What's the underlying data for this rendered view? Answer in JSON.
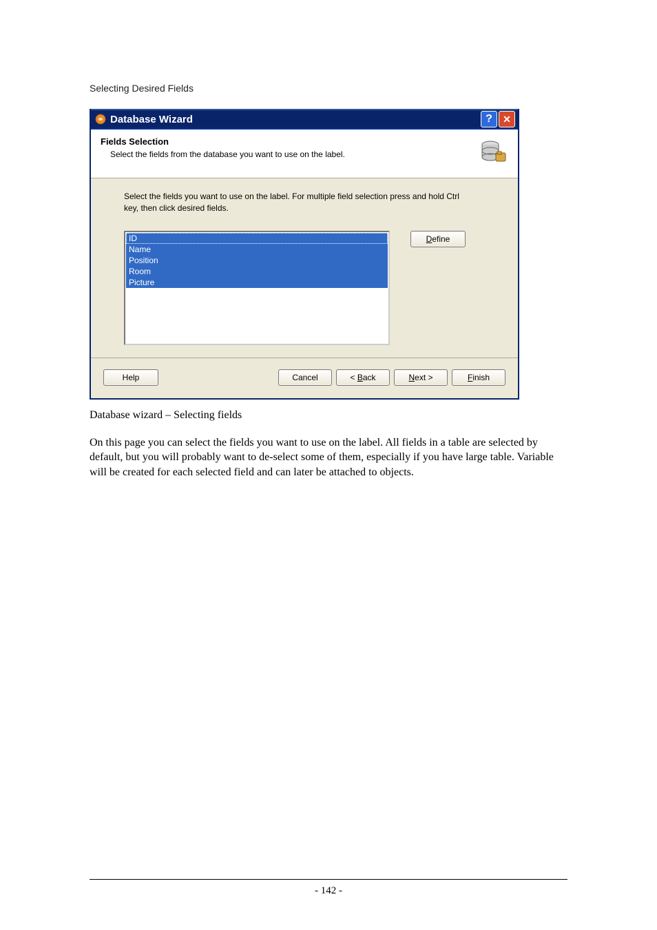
{
  "section_heading": "Selecting Desired Fields",
  "dialog": {
    "title": "Database Wizard",
    "header": {
      "title": "Fields Selection",
      "subtitle": "Select the fields from the database you want to use on the label."
    },
    "instruction": "Select the fields you want to use on the label. For multiple field selection press and hold Ctrl key, then click desired fields.",
    "fields": [
      "ID",
      "Name",
      "Position",
      "Room",
      "Picture"
    ],
    "define_label": "Define",
    "define_accel": "D",
    "buttons": {
      "help": "Help",
      "cancel": "Cancel",
      "back": "< Back",
      "back_accel": "B",
      "next": "Next >",
      "next_accel": "N",
      "finish": "Finish",
      "finish_accel": "F"
    }
  },
  "caption": "Database wizard – Selecting fields",
  "paragraph": "On this page you can select the fields you want to use on the label. All fields in a table are selected by default, but you will probably want to de-select some of them, especially if you have large table. Variable will be created for each selected field and can later be attached to objects.",
  "page_number": "- 142 -"
}
